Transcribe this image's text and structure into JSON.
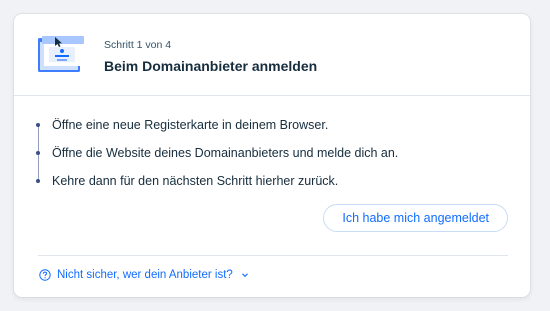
{
  "step": {
    "counter": "Schritt 1 von 4",
    "title": "Beim Domainanbieter anmelden"
  },
  "instructions": [
    "Öffne eine neue Registerkarte in deinem Browser.",
    "Öffne die Website deines Domainanbieters und melde dich an.",
    "Kehre dann für den nächsten Schritt hierher zurück."
  ],
  "primary_button": {
    "label": "Ich habe mich angemeldet"
  },
  "help": {
    "label": "Nicht sicher, wer dein Anbieter ist?"
  },
  "icons": {
    "illustration": "browser-login-illustration",
    "help": "question-circle-icon",
    "expand": "chevron-down-icon"
  },
  "colors": {
    "accent": "#116dff",
    "text": "#162d3d",
    "background": "#f0f2f5"
  }
}
